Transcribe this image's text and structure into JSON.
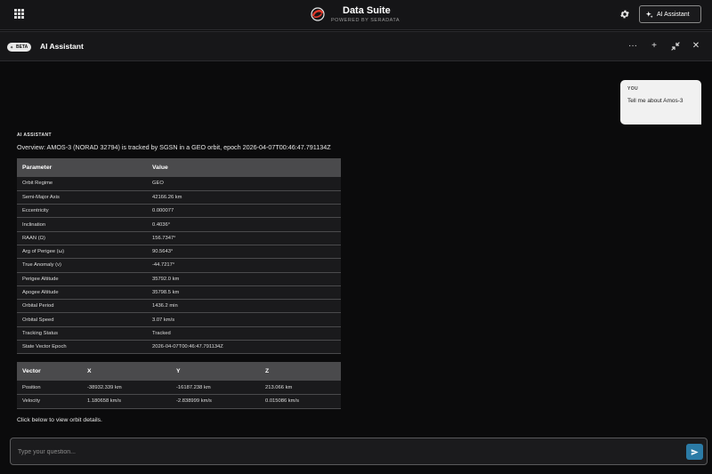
{
  "header": {
    "title": "Data Suite",
    "subtitle": "POWERED BY SERADATA",
    "ai_button_label": "AI Assistant"
  },
  "panel": {
    "badge": "BETA",
    "title": "AI Assistant",
    "more_label": "···",
    "add_label": "+",
    "close_label": "✕"
  },
  "conversation": {
    "user_label": "YOU",
    "user_message": "Tell me about Amos-3",
    "assistant_label": "AI ASSISTANT",
    "overview": "Overview: AMOS-3 (NORAD 32794) is tracked by SGSN in a GEO orbit, epoch 2026-04-07T00:46:47.791134Z",
    "params_table": {
      "headers": [
        "Parameter",
        "Value"
      ],
      "rows": [
        [
          "Orbit Regime",
          "GEO"
        ],
        [
          "Semi-Major Axis",
          "42166.26 km"
        ],
        [
          "Eccentricity",
          "0.000077"
        ],
        [
          "Inclination",
          "0.4036°"
        ],
        [
          "RAAN (Ω)",
          "156.7347°"
        ],
        [
          "Arg of Perigee (ω)",
          "90.5643°"
        ],
        [
          "True Anomaly (ν)",
          "-44.7217°"
        ],
        [
          "Perigee Altitude",
          "35792.0 km"
        ],
        [
          "Apogee Altitude",
          "35798.5 km"
        ],
        [
          "Orbital Period",
          "1436.2 min"
        ],
        [
          "Orbital Speed",
          "3.07 km/s"
        ],
        [
          "Tracking Status",
          "Tracked"
        ],
        [
          "State Vector Epoch",
          "2026-04-07T00:46:47.791134Z"
        ]
      ]
    },
    "vector_table": {
      "headers": [
        "Vector",
        "X",
        "Y",
        "Z"
      ],
      "rows": [
        [
          "Position",
          "-38932.339 km",
          "-16187.238 km",
          "213.066 km"
        ],
        [
          "Velocity",
          "1.180658 km/s",
          "-2.838999 km/s",
          "0.015086 km/s"
        ]
      ]
    },
    "footer_note": "Click below to view orbit details."
  },
  "composer": {
    "placeholder": "Type your question..."
  },
  "colors": {
    "background": "#0b0b0c",
    "table_header": "#4a4a4c",
    "send_button": "#2b7ba6",
    "logo_red": "#e0392b"
  }
}
